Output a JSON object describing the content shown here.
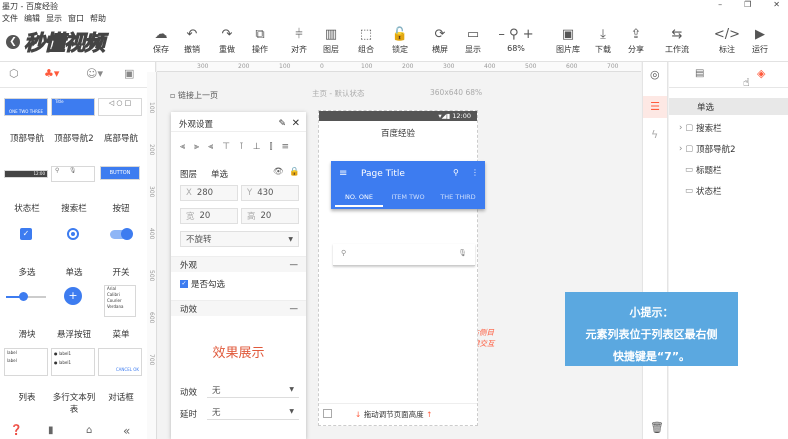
{
  "window": {
    "title": "墨刀 - 百度经验",
    "controls": [
      "–",
      "❐",
      "✕"
    ]
  },
  "menu": [
    "文件",
    "编辑",
    "显示",
    "窗口",
    "帮助"
  ],
  "logo": {
    "text": "秒懂视频"
  },
  "toolbar": [
    {
      "label": "保存",
      "icon": "cloud-upload-icon",
      "glyph": "☁"
    },
    {
      "label": "撤销",
      "icon": "undo-icon",
      "glyph": "↶"
    },
    {
      "label": "重做",
      "icon": "redo-icon",
      "glyph": "↷"
    },
    {
      "label": "操作",
      "icon": "copy-icon",
      "glyph": "⧉"
    },
    {
      "label": "对齐",
      "icon": "align-icon",
      "glyph": "⫩"
    },
    {
      "label": "图层",
      "icon": "layer-icon",
      "glyph": "▥"
    },
    {
      "label": "组合",
      "icon": "group-icon",
      "glyph": "⬚"
    },
    {
      "label": "锁定",
      "icon": "lock-icon",
      "glyph": "🔓"
    },
    {
      "label": "横屏",
      "icon": "rotate-icon",
      "glyph": "⟳"
    },
    {
      "label": "显示",
      "icon": "display-icon",
      "glyph": "▭"
    },
    {
      "label": "68%",
      "icon": "zoom-icon",
      "glyph": "– ⚲ +"
    },
    {
      "label": "图片库",
      "icon": "image-icon",
      "glyph": "▣"
    },
    {
      "label": "下载",
      "icon": "download-icon",
      "glyph": "⤓"
    },
    {
      "label": "分享",
      "icon": "share-icon",
      "glyph": "⇪"
    },
    {
      "label": "工作流",
      "icon": "workflow-icon",
      "glyph": "⇆"
    },
    {
      "label": "标注",
      "icon": "code-icon",
      "glyph": "</>"
    },
    {
      "label": "运行",
      "icon": "play-icon",
      "glyph": "▶"
    }
  ],
  "widgets": [
    {
      "label": "顶部导航"
    },
    {
      "label": "顶部导航2"
    },
    {
      "label": "底部导航"
    },
    {
      "label": "状态栏"
    },
    {
      "label": "搜索栏"
    },
    {
      "label": "按钮"
    },
    {
      "label": "多选"
    },
    {
      "label": "单选"
    },
    {
      "label": "开关"
    },
    {
      "label": "滑块"
    },
    {
      "label": "悬浮按钮"
    },
    {
      "label": "菜单"
    },
    {
      "label": "列表"
    },
    {
      "label": "多行文本列表"
    },
    {
      "label": "对话框"
    }
  ],
  "widget_thumbs": {
    "btn": "BUTTON",
    "tab": "ONE  TWO  THREE",
    "title": "Title",
    "menu": [
      "Arial",
      "Calibri",
      "Courier",
      "Verdana"
    ],
    "list": [
      "label",
      "label"
    ],
    "item": [
      "label1",
      "label1"
    ],
    "cancel": "CANCEL  OK",
    "time": "12:00"
  },
  "ruler": {
    "top": [
      "300",
      "200",
      "100",
      "0",
      "100",
      "200",
      "300",
      "400",
      "500",
      "600",
      "700"
    ],
    "left": [
      "100",
      "200",
      "300",
      "400",
      "500",
      "600",
      "700"
    ]
  },
  "canvas": {
    "link_up": "链接上一页",
    "state": "主页 - 默认状态",
    "size": "360x640 68%",
    "hint1": "拖动调节页面高度",
    "annot1": "拖动圆圈到右侧目",
    "annot2": "标页面创建交互"
  },
  "props": {
    "title": "外观设置",
    "layer_label": "图层",
    "layer_value": "单选",
    "x_label": "X",
    "x_value": "280",
    "y_label": "Y",
    "y_value": "430",
    "w_label": "宽",
    "w_value": "20",
    "h_label": "高",
    "h_value": "20",
    "rotate": "不旋转",
    "appearance": "外观",
    "checked": "是否勾选",
    "anim": "动效",
    "effect": "效果展示",
    "anim_label": "动效",
    "anim_value": "无",
    "delay_label": "延时",
    "delay_value": "无"
  },
  "phone": {
    "time": "12:00",
    "header": "百度经验",
    "appbar_title": "Page Title",
    "tabs": [
      "NO. ONE",
      "ITEM TWO",
      "THE THIRD"
    ]
  },
  "tree": {
    "selected": "单选",
    "items": [
      {
        "label": "搜索栏"
      },
      {
        "label": "顶部导航2"
      },
      {
        "label": "标题栏"
      },
      {
        "label": "状态栏"
      }
    ]
  },
  "tip": {
    "title": "小提示：",
    "line1": "元素列表位于列表区最右侧",
    "line2": "快捷键是“7”。"
  },
  "colors": {
    "primary": "#3d7cf0",
    "tip": "#5ba8e0",
    "accent": "#ff5a3c"
  }
}
